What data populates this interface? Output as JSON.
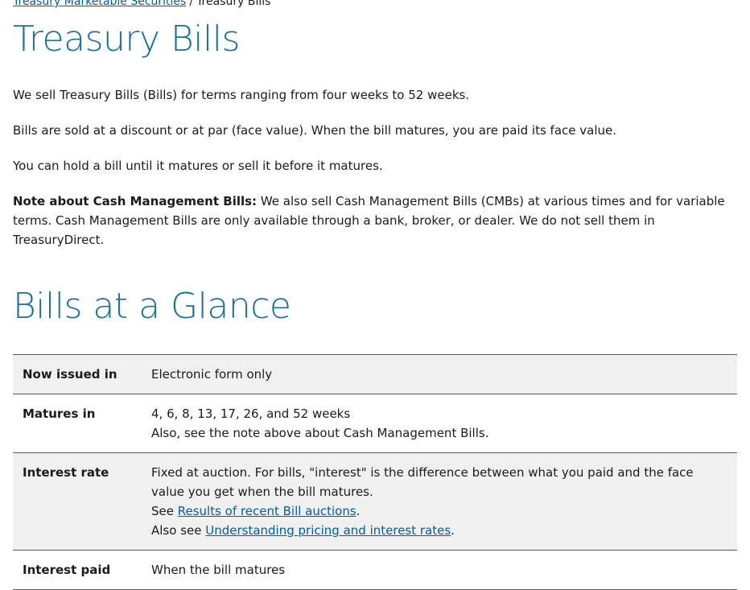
{
  "breadcrumb": {
    "parent": "Treasury Marketable Securities",
    "separator": "/",
    "current": "Treasury Bills"
  },
  "page_title": "Treasury Bills",
  "intro": {
    "p1": "We sell Treasury Bills (Bills) for terms ranging from four weeks to 52 weeks.",
    "p2": "Bills are sold at a discount or at par (face value). When the bill matures, you are paid its face value.",
    "p3": "You can hold a bill until it matures or sell it before it matures.",
    "note_label": "Note about Cash Management Bills:",
    "note_text": " We also sell Cash Management Bills (CMBs) at various times and for variable terms. Cash Management Bills are only available through a bank, broker, or dealer. We do not sell them in TreasuryDirect."
  },
  "section_title": "Bills at a Glance",
  "glance": {
    "issued": {
      "label": "Now issued in",
      "value": "Electronic form only"
    },
    "matures": {
      "label": "Matures in",
      "line1": "4, 6, 8, 13, 17, 26, and 52 weeks",
      "line2": "Also, see the note above about Cash Management Bills."
    },
    "rate": {
      "label": "Interest rate",
      "line1": "Fixed at auction. For bills, \"interest\" is the difference between what you paid and the face value you get when the bill matures.",
      "see_prefix": "See ",
      "see_link": "Results of recent Bill auctions",
      "see_suffix": ".",
      "also_prefix": "Also see ",
      "also_link": "Understanding pricing and interest rates",
      "also_suffix": "."
    },
    "paid": {
      "label": "Interest paid",
      "value": "When the bill matures"
    }
  }
}
